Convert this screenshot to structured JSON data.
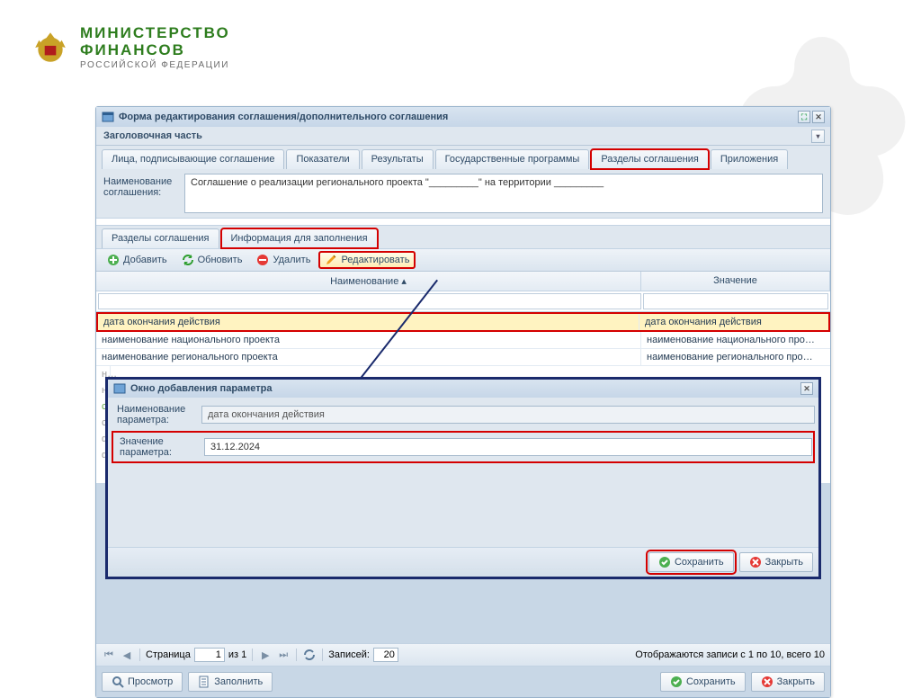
{
  "ministry": {
    "line1": "МИНИСТЕРСТВО",
    "line2": "ФИНАНСОВ",
    "sub": "РОССИЙСКОЙ ФЕДЕРАЦИИ"
  },
  "window": {
    "title": "Форма редактирования соглашения/дополнительного соглашения",
    "section_header": "Заголовочная часть",
    "tabs": [
      "Лица, подписывающие соглашение",
      "Показатели",
      "Результаты",
      "Государственные программы",
      "Разделы соглашения",
      "Приложения"
    ],
    "name_label": "Наименование соглашения:",
    "name_value": "Соглашение о реализации регионального проекта \"_________\" на территории _________",
    "subtabs": [
      "Разделы соглашения",
      "Информация для заполнения"
    ],
    "toolbar": {
      "add": "Добавить",
      "refresh": "Обновить",
      "delete": "Удалить",
      "edit": "Редактировать"
    },
    "grid": {
      "col_name": "Наименование",
      "col_value": "Значение",
      "rows": [
        {
          "name": "дата окончания действия",
          "value": "дата окончания действия"
        },
        {
          "name": "наименование национального проекта",
          "value": "наименование национального про…"
        },
        {
          "name": "наименование регионального проекта",
          "value": "наименование регионального про…"
        }
      ],
      "stub_labels": [
        "н…",
        "н…",
        "ср",
        "ср",
        "ф…",
        "ф…"
      ]
    },
    "modal": {
      "title": "Окно добавления параметра",
      "name_label": "Наименование параметра:",
      "name_value": "дата окончания действия",
      "value_label": "Значение параметра:",
      "value_value": "31.12.2024",
      "save": "Сохранить",
      "close": "Закрыть"
    },
    "pager": {
      "page_label": "Страница",
      "page_value": "1",
      "of_label": "из 1",
      "records_label": "Записей:",
      "records_value": "20",
      "summary": "Отображаются записи с 1 по 10, всего 10"
    },
    "footer": {
      "preview": "Просмотр",
      "fill": "Заполнить",
      "save": "Сохранить",
      "close": "Закрыть"
    }
  }
}
